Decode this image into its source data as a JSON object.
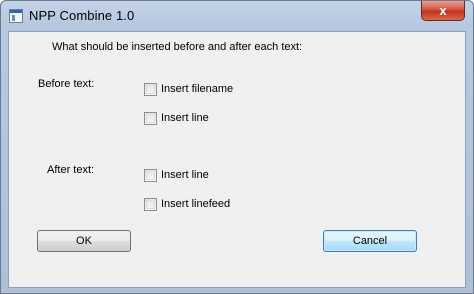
{
  "window": {
    "title": "NPP Combine 1.0",
    "close_glyph": "x"
  },
  "dialog": {
    "prompt": "What should be inserted before and after each text:",
    "before_label": "Before text:",
    "before_options": [
      {
        "label": "Insert filename",
        "checked": false
      },
      {
        "label": "Insert line",
        "checked": false
      }
    ],
    "after_label": "After text:",
    "after_options": [
      {
        "label": "Insert line",
        "checked": false
      },
      {
        "label": "Insert linefeed",
        "checked": false
      }
    ],
    "ok_label": "OK",
    "cancel_label": "Cancel"
  },
  "icons": {
    "app": "window-app-icon",
    "close": "close-icon"
  },
  "colors": {
    "frame": "#b7c9e0",
    "client": "#f0f0f0",
    "close_button": "#c7432b",
    "focused_button": "#bee6fd"
  }
}
